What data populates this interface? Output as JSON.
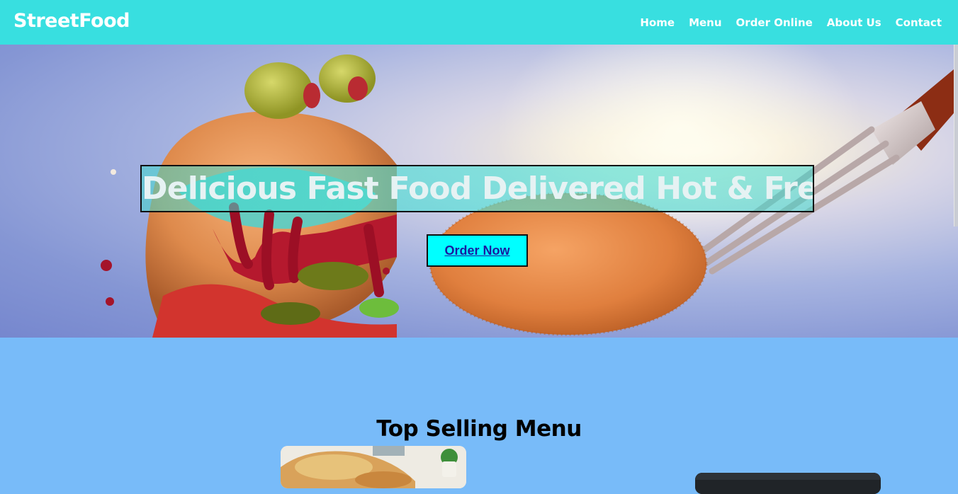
{
  "brand": {
    "name": "StreetFood"
  },
  "nav": {
    "items": [
      {
        "label": "Home"
      },
      {
        "label": "Menu"
      },
      {
        "label": "Order Online"
      },
      {
        "label": "About Us"
      },
      {
        "label": "Contact"
      }
    ]
  },
  "hero": {
    "headline": "Delicious Fast Food Delivered Hot & Fresh",
    "cta_label": "Order Now"
  },
  "top_menu": {
    "title": "Top Selling Menu"
  },
  "colors": {
    "navbar": "#38dfe0",
    "section_bg": "#78bbf9",
    "cta_bg": "#00ffff",
    "cta_text": "#1a1aa0"
  }
}
